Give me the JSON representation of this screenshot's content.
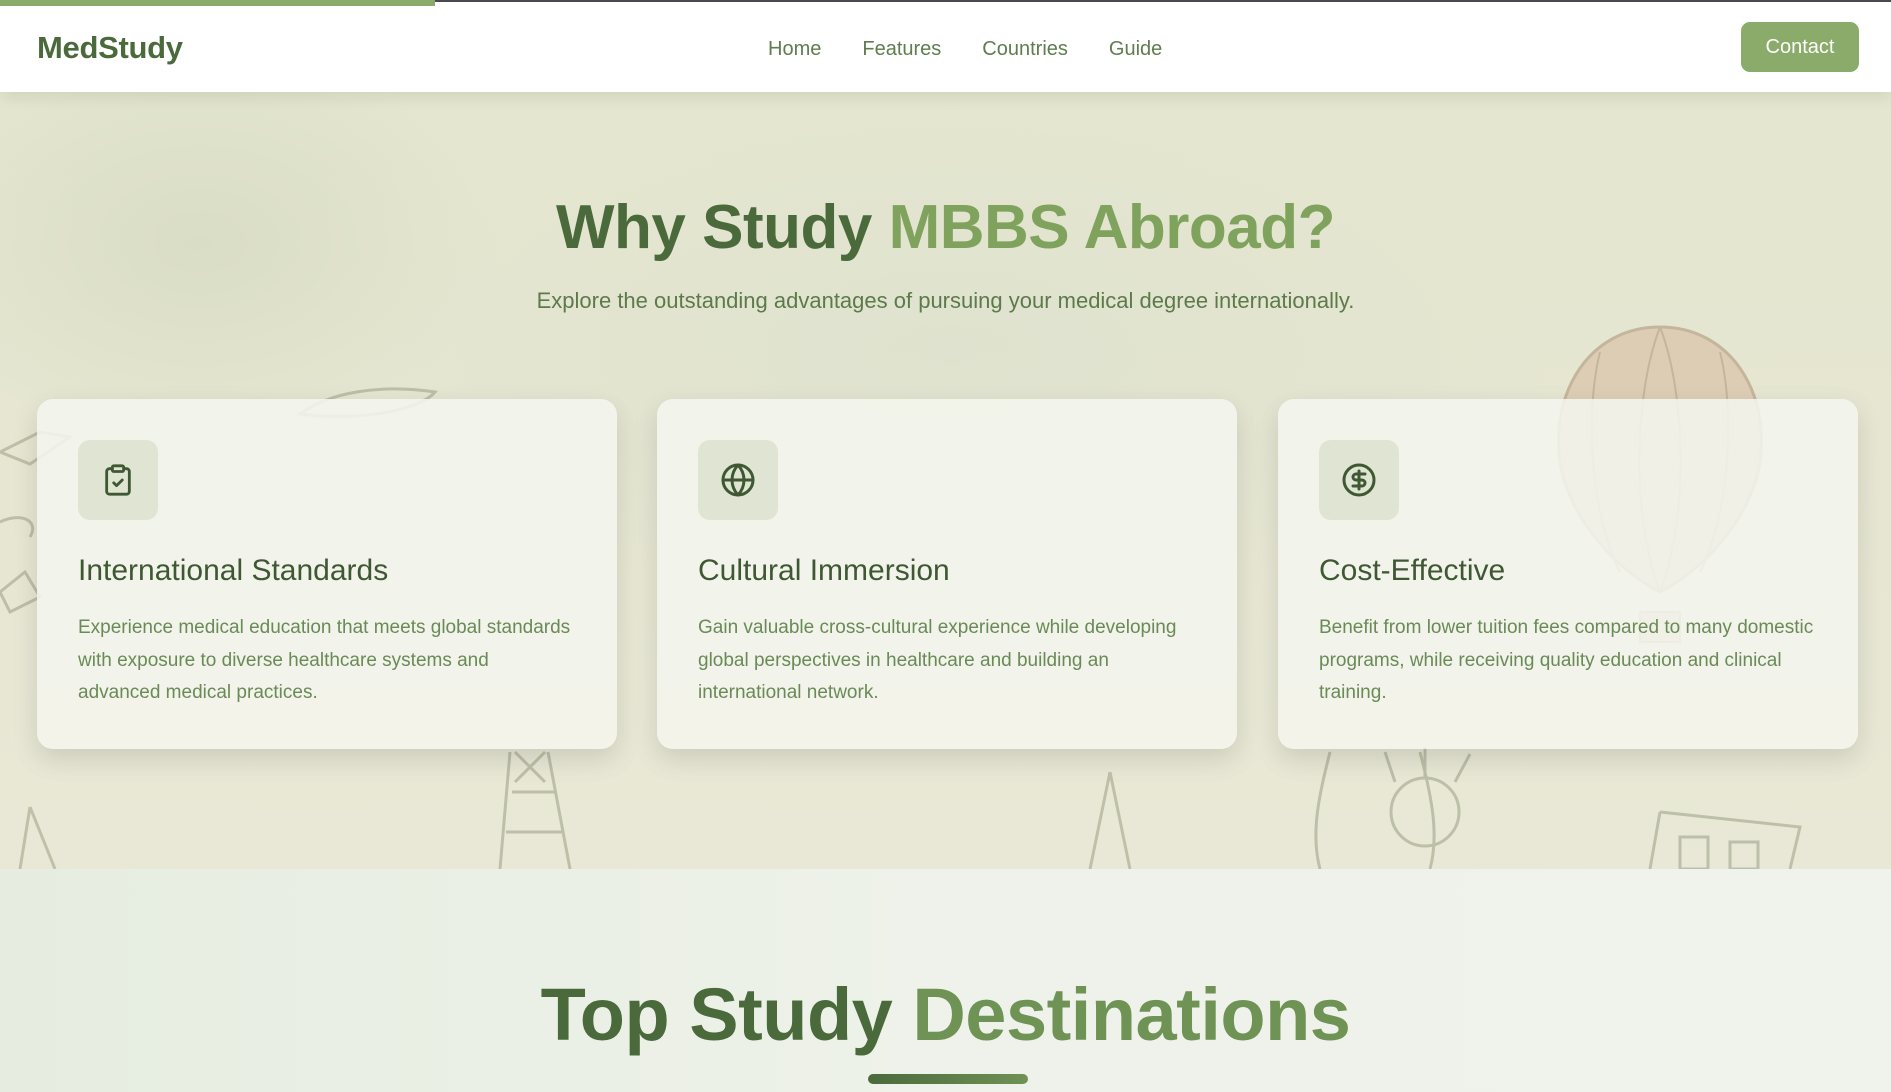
{
  "header": {
    "logo": "MedStudy",
    "nav": [
      "Home",
      "Features",
      "Countries",
      "Guide"
    ],
    "contact_label": "Contact",
    "scroll_progress": 0.23
  },
  "hero": {
    "title_part1": "Why Study",
    "title_part2": "MBBS Abroad?",
    "subtitle": "Explore the outstanding advantages of pursuing your medical degree internationally.",
    "cards": [
      {
        "icon": "clipboard-check-icon",
        "title": "International Standards",
        "text": "Experience medical education that meets global standards with exposure to diverse healthcare systems and advanced medical practices."
      },
      {
        "icon": "globe-icon",
        "title": "Cultural Immersion",
        "text": "Gain valuable cross-cultural experience while developing global perspectives in healthcare and building an international network."
      },
      {
        "icon": "dollar-circle-icon",
        "title": "Cost-Effective",
        "text": "Benefit from lower tuition fees compared to many domestic programs, while receiving quality education and clinical training."
      }
    ]
  },
  "destinations": {
    "title_part1": "Top Study",
    "title_part2": "Destinations"
  },
  "colors": {
    "brand_dark": "#4b6a3c",
    "brand_light": "#8aab6a",
    "text_muted": "#6a8a57"
  }
}
